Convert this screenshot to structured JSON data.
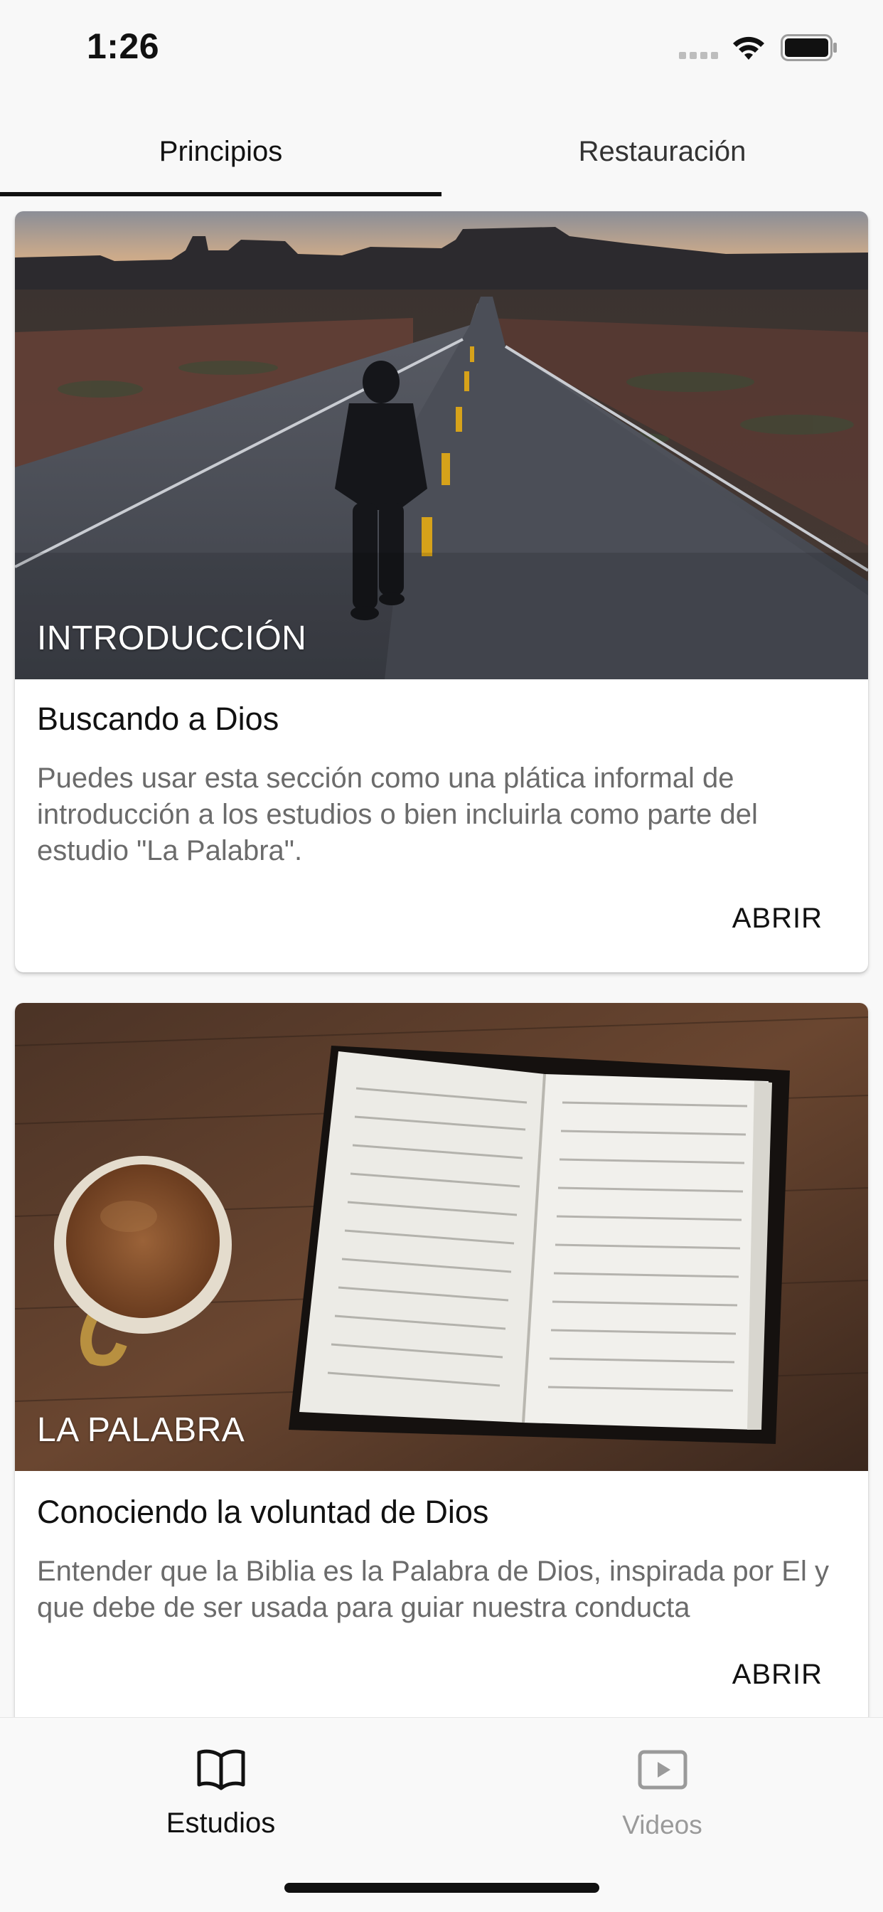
{
  "status_bar": {
    "time": "1:26"
  },
  "tabs": [
    {
      "label": "Principios",
      "selected": true
    },
    {
      "label": "Restauración",
      "selected": false
    }
  ],
  "cards": [
    {
      "overline": "INTRODUCCIÓN",
      "title": "Buscando a Dios",
      "description": "Puedes usar esta sección como una plática informal de introducción a los estudios o bien incluirla como parte del estudio \"La Palabra\".",
      "action": "ABRIR"
    },
    {
      "overline": "LA PALABRA",
      "title": "Conociendo la voluntad de Dios",
      "description": "Entender que la Biblia es la Palabra de Dios, inspirada por El y que debe de ser usada para guiar nuestra conducta",
      "action": "ABRIR"
    }
  ],
  "bottom_nav": [
    {
      "label": "Estudios",
      "icon": "book-open-icon",
      "selected": true
    },
    {
      "label": "Videos",
      "icon": "play-video-icon",
      "selected": false
    }
  ],
  "colors": {
    "selected_text": "#111111",
    "unselected_nav": "#9a9a9a",
    "description_text": "#6b6b6b"
  }
}
